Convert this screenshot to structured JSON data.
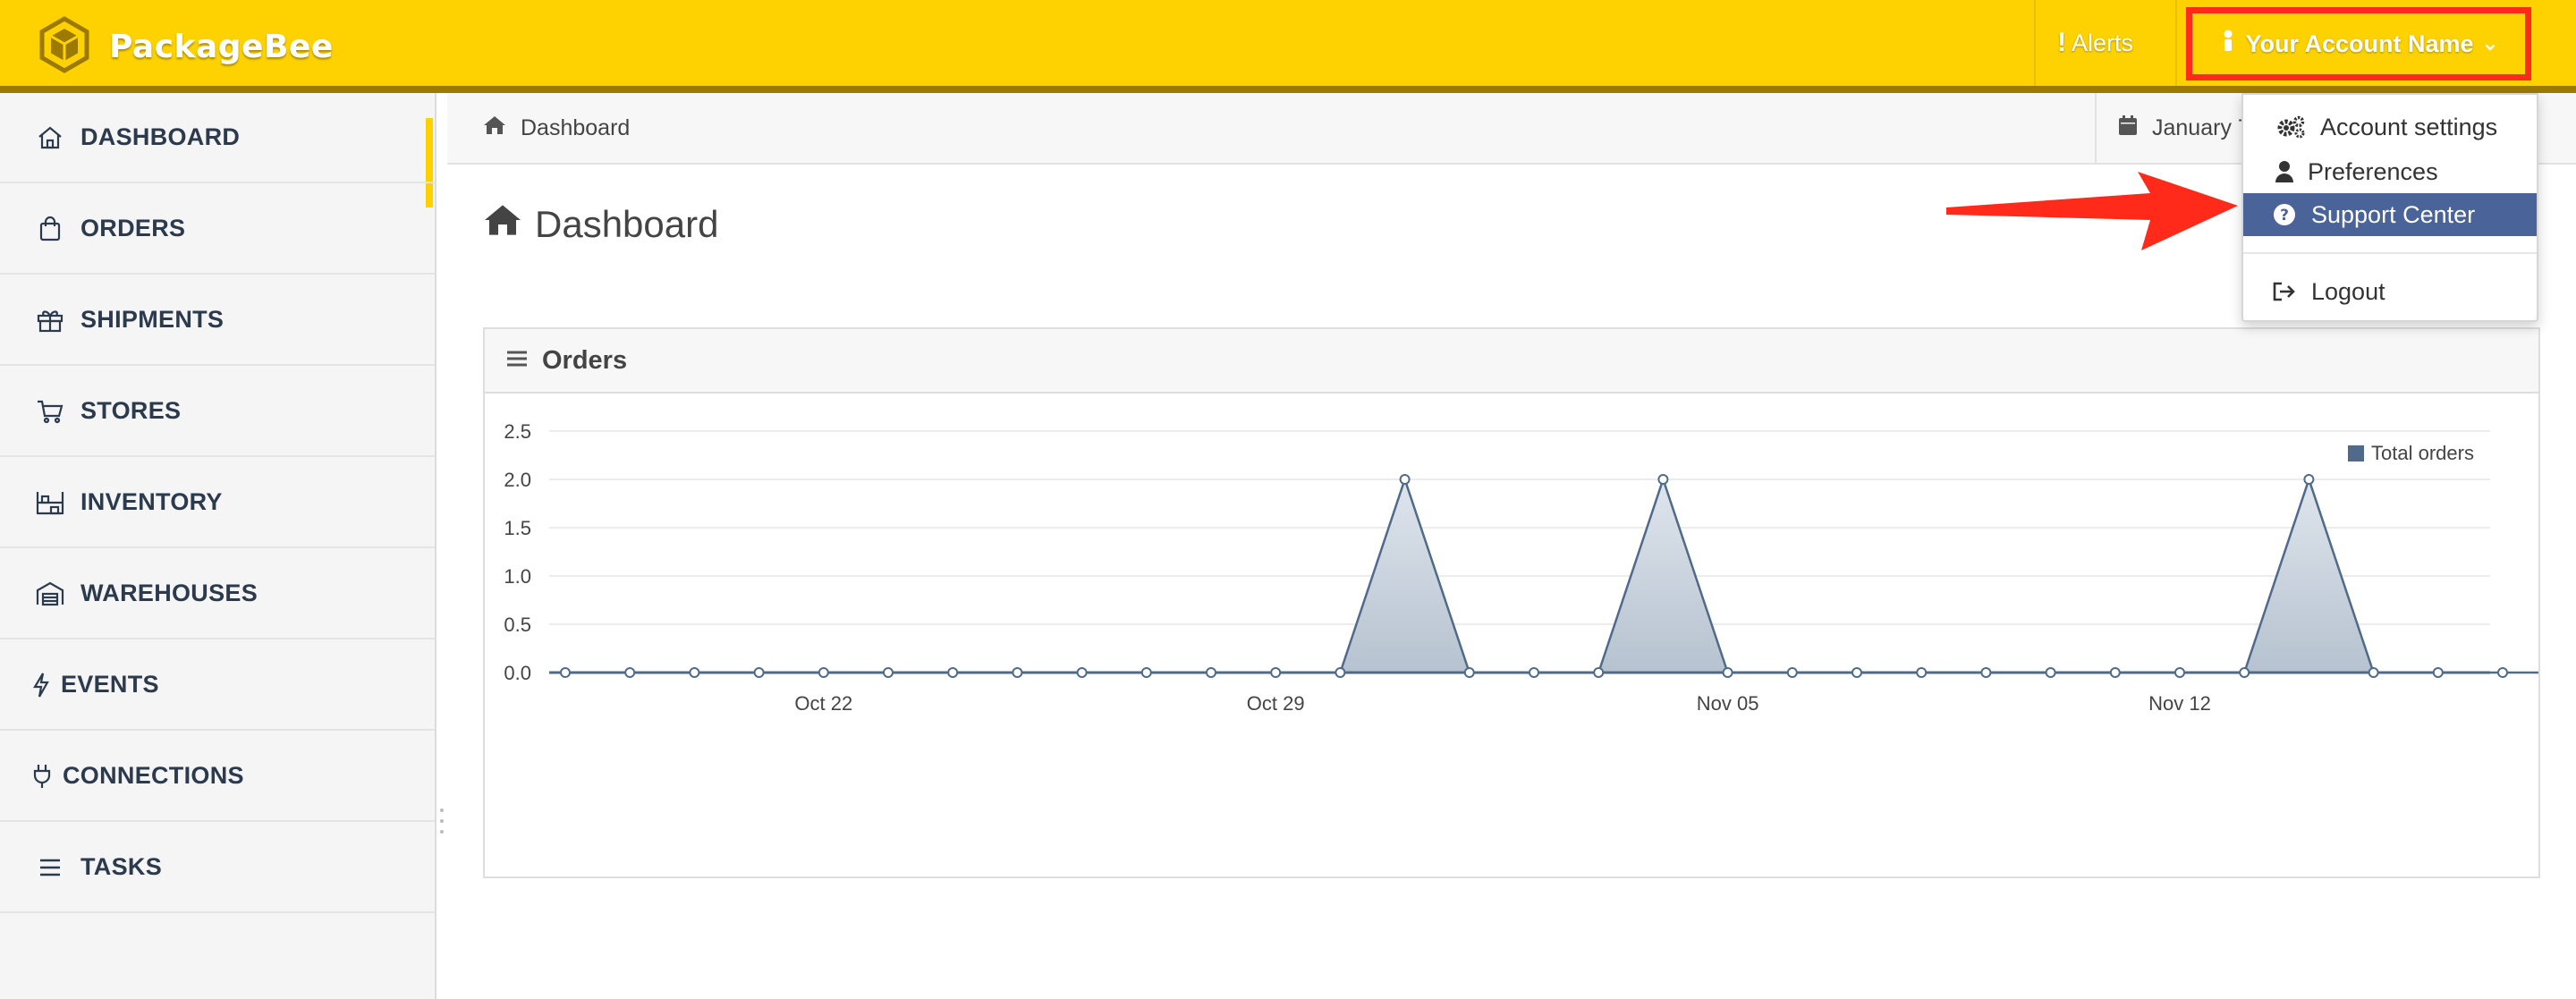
{
  "app": {
    "name": "PackageBee"
  },
  "topnav": {
    "alerts_label": "Alerts",
    "account_label": "Your Account Name",
    "highlight_color": "#ff2a1a"
  },
  "sidebar": {
    "active_item": "DASHBOARD",
    "items": [
      {
        "label": "DASHBOARD",
        "icon": "home-icon"
      },
      {
        "label": "ORDERS",
        "icon": "shopping-bag-icon"
      },
      {
        "label": "SHIPMENTS",
        "icon": "gift-icon"
      },
      {
        "label": "STORES",
        "icon": "shopping-cart-icon"
      },
      {
        "label": "INVENTORY",
        "icon": "shelves-icon"
      },
      {
        "label": "WAREHOUSES",
        "icon": "warehouse-icon"
      },
      {
        "label": "EVENTS",
        "icon": "lightning-icon"
      },
      {
        "label": "CONNECTIONS",
        "icon": "plug-icon"
      },
      {
        "label": "TASKS",
        "icon": "list-icon"
      }
    ]
  },
  "breadcrumb": {
    "label": "Dashboard"
  },
  "date_range": {
    "label": "January 7"
  },
  "page": {
    "title": "Dashboard"
  },
  "orders_panel": {
    "title": "Orders"
  },
  "account_menu": {
    "items": [
      {
        "label": "Account settings",
        "icon": "gears-icon"
      },
      {
        "label": "Preferences",
        "icon": "user-icon"
      },
      {
        "label": "Support Center",
        "icon": "question-circle-icon",
        "selected": true
      },
      {
        "label": "Logout",
        "icon": "sign-out-icon"
      }
    ]
  },
  "colors": {
    "brand_yellow": "#fdd200",
    "menu_selected": "#4a6398",
    "series_line": "#4f6a8a",
    "arrow": "#ff2a1a"
  },
  "chart_data": {
    "type": "area",
    "series": [
      {
        "name": "Total orders",
        "values": [
          0,
          0,
          0,
          0,
          0,
          0,
          0,
          0,
          0,
          0,
          0,
          0,
          0,
          2,
          0,
          0,
          0,
          2,
          0,
          0,
          0,
          0,
          0,
          0,
          0,
          0,
          0,
          2,
          0,
          0,
          0,
          0
        ]
      }
    ],
    "x_tick_labels": [
      {
        "index": 4,
        "label": "Oct 22"
      },
      {
        "index": 11,
        "label": "Oct 29"
      },
      {
        "index": 18,
        "label": "Nov 05"
      },
      {
        "index": 25,
        "label": "Nov 12"
      }
    ],
    "yticks": [
      "0.0",
      "0.5",
      "1.0",
      "1.5",
      "2.0",
      "2.5"
    ],
    "ylim": [
      0,
      2.5
    ],
    "grid": "horizontal",
    "legend_position": "top-right"
  }
}
